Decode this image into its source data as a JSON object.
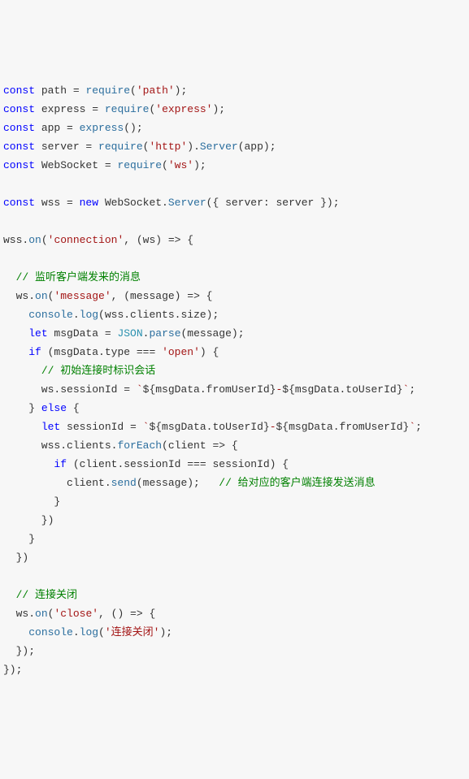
{
  "tokens": [
    [
      [
        "kw",
        "const"
      ],
      [
        "plain",
        " path = "
      ],
      [
        "fn",
        "require"
      ],
      [
        "plain",
        "("
      ],
      [
        "str",
        "'path'"
      ],
      [
        "plain",
        ");"
      ]
    ],
    [
      [
        "kw",
        "const"
      ],
      [
        "plain",
        " express = "
      ],
      [
        "fn",
        "require"
      ],
      [
        "plain",
        "("
      ],
      [
        "str",
        "'express'"
      ],
      [
        "plain",
        ");"
      ]
    ],
    [
      [
        "kw",
        "const"
      ],
      [
        "plain",
        " app = "
      ],
      [
        "fn",
        "express"
      ],
      [
        "plain",
        "();"
      ]
    ],
    [
      [
        "kw",
        "const"
      ],
      [
        "plain",
        " server = "
      ],
      [
        "fn",
        "require"
      ],
      [
        "plain",
        "("
      ],
      [
        "str",
        "'http'"
      ],
      [
        "plain",
        ")."
      ],
      [
        "fn",
        "Server"
      ],
      [
        "plain",
        "(app);"
      ]
    ],
    [
      [
        "kw",
        "const"
      ],
      [
        "plain",
        " WebSocket = "
      ],
      [
        "fn",
        "require"
      ],
      [
        "plain",
        "("
      ],
      [
        "str",
        "'ws'"
      ],
      [
        "plain",
        ");"
      ]
    ],
    [],
    [
      [
        "kw",
        "const"
      ],
      [
        "plain",
        " wss = "
      ],
      [
        "kw",
        "new"
      ],
      [
        "plain",
        " WebSocket."
      ],
      [
        "fn",
        "Server"
      ],
      [
        "plain",
        "({ server: server });"
      ]
    ],
    [],
    [
      [
        "plain",
        "wss."
      ],
      [
        "fn",
        "on"
      ],
      [
        "plain",
        "("
      ],
      [
        "str",
        "'connection'"
      ],
      [
        "plain",
        ", (ws) => {"
      ]
    ],
    [],
    [
      [
        "plain",
        "  "
      ],
      [
        "cmt",
        "// 监听客户端发来的消息"
      ]
    ],
    [
      [
        "plain",
        "  ws."
      ],
      [
        "fn",
        "on"
      ],
      [
        "plain",
        "("
      ],
      [
        "str",
        "'message'"
      ],
      [
        "plain",
        ", (message) => {"
      ]
    ],
    [
      [
        "plain",
        "    "
      ],
      [
        "fn",
        "console"
      ],
      [
        "plain",
        "."
      ],
      [
        "fn",
        "log"
      ],
      [
        "plain",
        "(wss.clients.size);"
      ]
    ],
    [
      [
        "plain",
        "    "
      ],
      [
        "kw",
        "let"
      ],
      [
        "plain",
        " msgData = "
      ],
      [
        "cls",
        "JSON"
      ],
      [
        "plain",
        "."
      ],
      [
        "fn",
        "parse"
      ],
      [
        "plain",
        "(message);"
      ]
    ],
    [
      [
        "plain",
        "    "
      ],
      [
        "kw",
        "if"
      ],
      [
        "plain",
        " (msgData.type === "
      ],
      [
        "str",
        "'open'"
      ],
      [
        "plain",
        ") {"
      ]
    ],
    [
      [
        "plain",
        "      "
      ],
      [
        "cmt",
        "// 初始连接时标识会话"
      ]
    ],
    [
      [
        "plain",
        "      ws.sessionId = "
      ],
      [
        "tmpl",
        "`"
      ],
      [
        "tmplint",
        "${msgData.fromUserId}"
      ],
      [
        "tmpl",
        "-"
      ],
      [
        "tmplint",
        "${msgData.toUserId}"
      ],
      [
        "tmpl",
        "`"
      ],
      [
        "plain",
        ";"
      ]
    ],
    [
      [
        "plain",
        "    } "
      ],
      [
        "kw",
        "else"
      ],
      [
        "plain",
        " {"
      ]
    ],
    [
      [
        "plain",
        "      "
      ],
      [
        "kw",
        "let"
      ],
      [
        "plain",
        " sessionId = "
      ],
      [
        "tmpl",
        "`"
      ],
      [
        "tmplint",
        "${msgData.toUserId}"
      ],
      [
        "tmpl",
        "-"
      ],
      [
        "tmplint",
        "${msgData.fromUserId}"
      ],
      [
        "tmpl",
        "`"
      ],
      [
        "plain",
        ";"
      ]
    ],
    [
      [
        "plain",
        "      wss.clients."
      ],
      [
        "fn",
        "forEach"
      ],
      [
        "plain",
        "(client => {"
      ]
    ],
    [
      [
        "plain",
        "        "
      ],
      [
        "kw",
        "if"
      ],
      [
        "plain",
        " (client.sessionId === sessionId) {"
      ]
    ],
    [
      [
        "plain",
        "          client."
      ],
      [
        "fn",
        "send"
      ],
      [
        "plain",
        "(message);   "
      ],
      [
        "cmt",
        "// 给对应的客户端连接发送消息"
      ]
    ],
    [
      [
        "plain",
        "        }"
      ]
    ],
    [
      [
        "plain",
        "      })"
      ]
    ],
    [
      [
        "plain",
        "    }"
      ]
    ],
    [
      [
        "plain",
        "  })"
      ]
    ],
    [],
    [
      [
        "plain",
        "  "
      ],
      [
        "cmt",
        "// 连接关闭"
      ]
    ],
    [
      [
        "plain",
        "  ws."
      ],
      [
        "fn",
        "on"
      ],
      [
        "plain",
        "("
      ],
      [
        "str",
        "'close'"
      ],
      [
        "plain",
        ", () => {"
      ]
    ],
    [
      [
        "plain",
        "    "
      ],
      [
        "fn",
        "console"
      ],
      [
        "plain",
        "."
      ],
      [
        "fn",
        "log"
      ],
      [
        "plain",
        "("
      ],
      [
        "str",
        "'连接关闭'"
      ],
      [
        "plain",
        ");"
      ]
    ],
    [
      [
        "plain",
        "  });"
      ]
    ],
    [
      [
        "plain",
        "});"
      ]
    ]
  ]
}
